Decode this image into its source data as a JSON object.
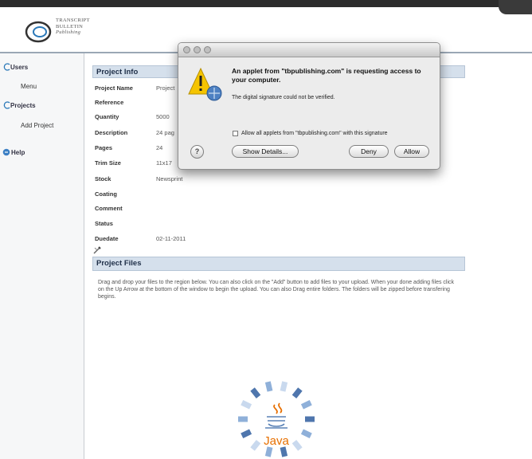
{
  "header": {
    "logo_line1": "TRANSCRIPT",
    "logo_line2": "BULLETIN",
    "logo_line3": "Publishing"
  },
  "sidebar": {
    "items": [
      {
        "label": "Users"
      },
      {
        "label": "Menu"
      },
      {
        "label": "Projects"
      },
      {
        "label": "Add Project"
      },
      {
        "label": "Help"
      }
    ]
  },
  "project_info": {
    "title": "Project Info",
    "fields": [
      {
        "label": "Project Name",
        "value": "Project"
      },
      {
        "label": "Reference",
        "value": ""
      },
      {
        "label": "Quantity",
        "value": "5000"
      },
      {
        "label": "Description",
        "value": "24 pag"
      },
      {
        "label": "Pages",
        "value": "24"
      },
      {
        "label": "Trim Size",
        "value": "11x17"
      },
      {
        "label": "Stock",
        "value": "Newsprint"
      },
      {
        "label": "Coating",
        "value": ""
      },
      {
        "label": "Comment",
        "value": ""
      },
      {
        "label": "Status",
        "value": ""
      },
      {
        "label": "Duedate",
        "value": "02-11-2011"
      }
    ]
  },
  "project_files": {
    "title": "Project Files",
    "instructions": "Drag and drop your files to the region below. You can also click on the \"Add\" button to add files to your upload. When your done adding files click on the Up Arrow at the bottom of the window to begin the upload. You can also Drag entire folders. The folders will be zipped before transfering begins."
  },
  "dialog": {
    "title": "An applet from \"tbpublishing.com\" is requesting access to your computer.",
    "subtitle": "The digital signature could not be verified.",
    "checkbox_label": "Allow all applets from \"tbpublishing.com\" with this signature",
    "show_details": "Show Details...",
    "deny": "Deny",
    "allow": "Allow",
    "help": "?"
  },
  "java": {
    "label": "Java"
  },
  "colors": {
    "section_header_bg": "#d5e0ec",
    "java_blue": "#5a82b6",
    "java_orange": "#e76f00"
  }
}
